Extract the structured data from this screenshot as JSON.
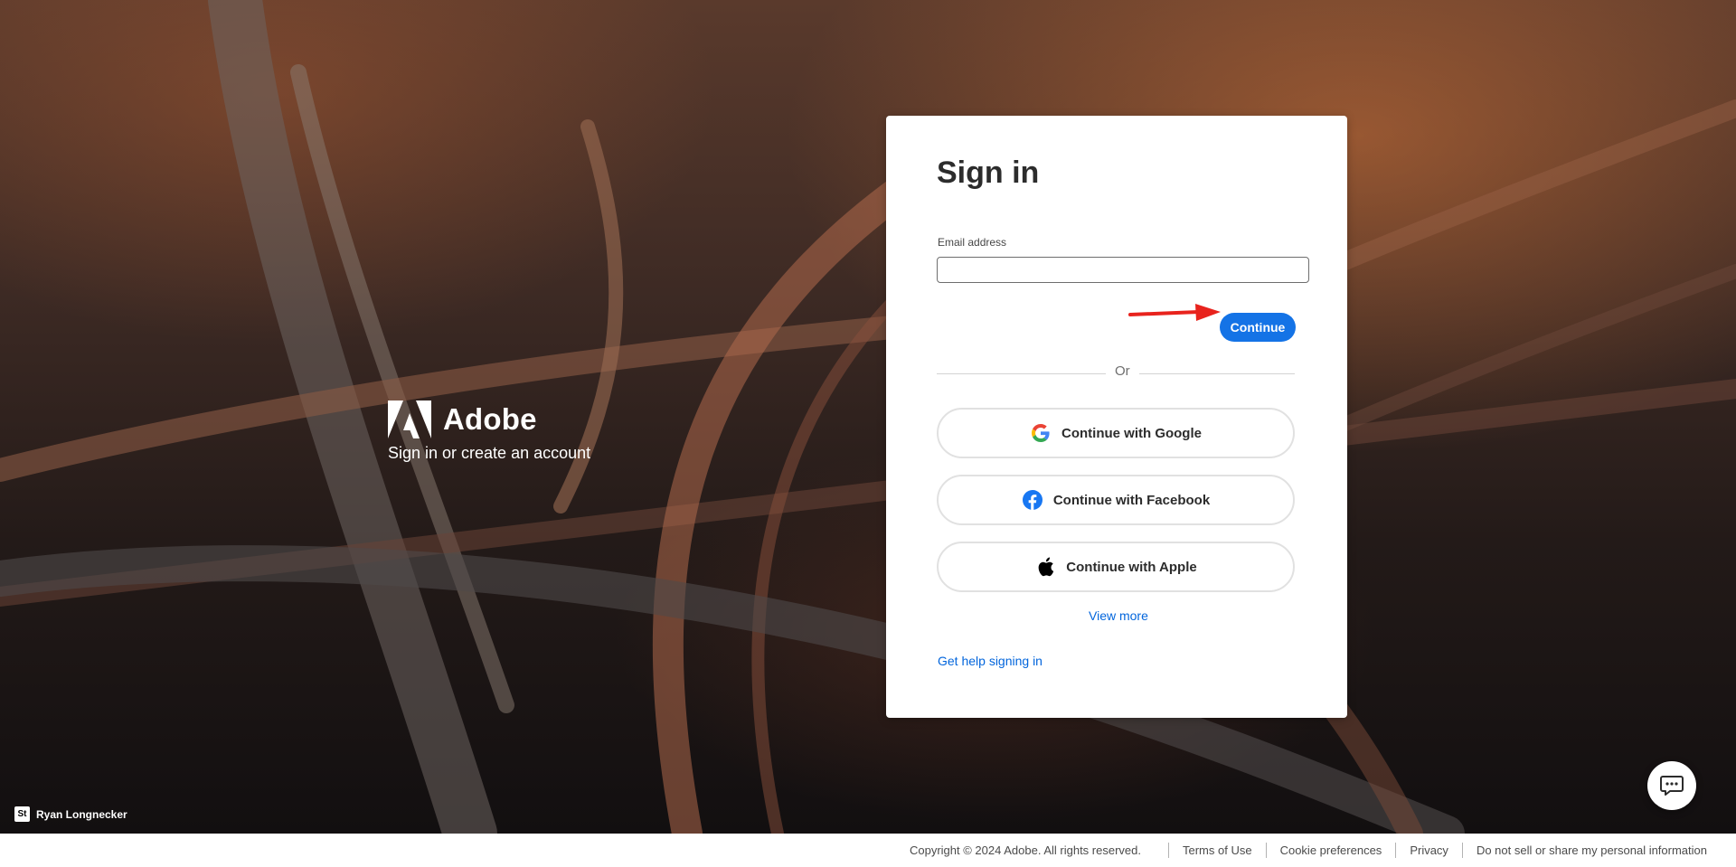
{
  "background": {
    "photo_credit": {
      "badge": "St",
      "name": "Ryan Longnecker"
    }
  },
  "brand": {
    "name": "Adobe",
    "tagline": "Sign in or create an account"
  },
  "signin_card": {
    "title": "Sign in",
    "email_label": "Email address",
    "email_value": "",
    "continue_label": "Continue",
    "divider_text": "Or",
    "social_buttons": [
      {
        "label": "Continue with Google",
        "icon": "google-icon"
      },
      {
        "label": "Continue with Facebook",
        "icon": "facebook-icon"
      },
      {
        "label": "Continue with Apple",
        "icon": "apple-icon"
      }
    ],
    "view_more": "View more",
    "help_link": "Get help signing in"
  },
  "chat_button": {
    "icon": "chat-icon"
  },
  "footer": {
    "copyright": "Copyright © 2024 Adobe. All rights reserved.",
    "links": [
      "Terms of Use",
      "Cookie preferences",
      "Privacy",
      "Do not sell or share my personal information"
    ]
  },
  "colors": {
    "accent": "#1473e6",
    "link": "#0265dc",
    "annotation_arrow": "#e8231d"
  }
}
